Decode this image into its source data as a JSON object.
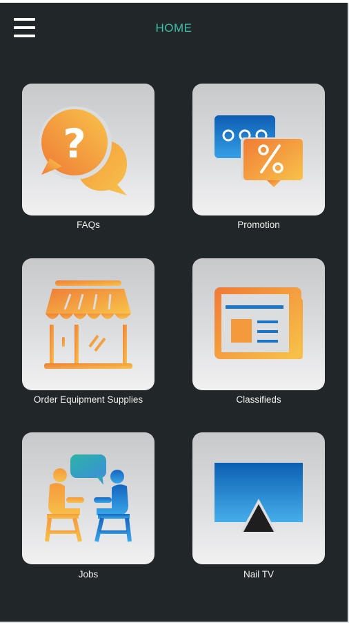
{
  "header": {
    "title": "HOME"
  },
  "tiles": [
    {
      "label": "FAQs",
      "icon": "faq-chat-icon"
    },
    {
      "label": "Promotion",
      "icon": "promotion-tag-icon"
    },
    {
      "label": "Order Equipment Supplies",
      "icon": "storefront-icon"
    },
    {
      "label": "Classifieds",
      "icon": "newspaper-icon"
    },
    {
      "label": "Jobs",
      "icon": "job-interview-icon"
    },
    {
      "label": "Nail TV",
      "icon": "tv-screen-icon"
    }
  ],
  "colors": {
    "background": "#212629",
    "title": "#3cc0a7",
    "accent_orange": "#f08a3a",
    "accent_yellow": "#f7c24a",
    "accent_blue": "#1b75c4"
  }
}
